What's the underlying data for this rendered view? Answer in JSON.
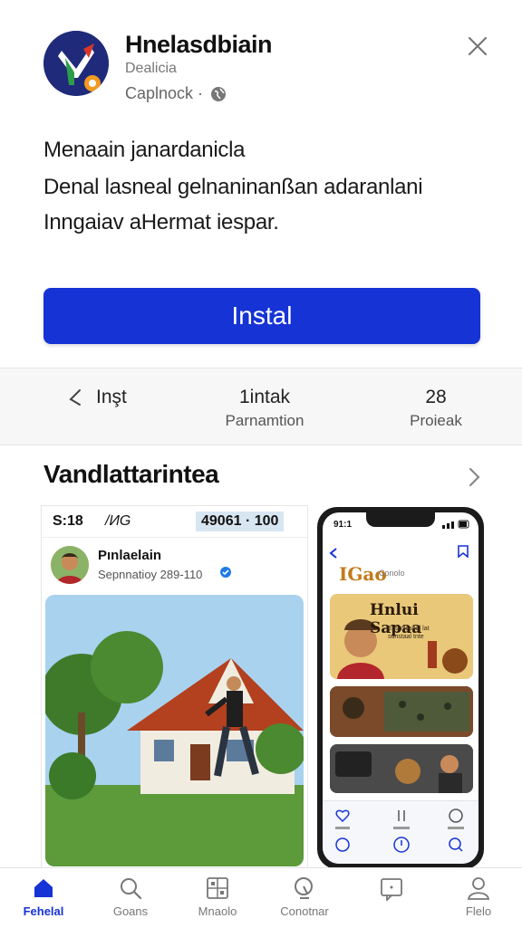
{
  "app": {
    "name": "Hnelasdbiain",
    "developer": "Dealicia",
    "category": "Caplnock ·"
  },
  "description": {
    "line1": "Menaain janardanicla",
    "line2": "Denal lasneal gelnaninanßan adaranlani",
    "line3": "Inngaiav aHermat iespar."
  },
  "install_label": "Instal",
  "stats": [
    {
      "value": "Inşt",
      "label": ""
    },
    {
      "value": "1intak",
      "label": "Parnamtion"
    },
    {
      "value": "28",
      "label": "Proieak"
    }
  ],
  "section_title": "Vandlattarintea",
  "screenshot1": {
    "status_time": "S:18",
    "status_mid": "/ИG",
    "status_right": "49061 · 100",
    "post_name": "Pınlaelain",
    "post_meta": "Sepnnatioy 289-110"
  },
  "screenshot2": {
    "status_time": "91:1",
    "logo_text": "IGao",
    "header_text": "Conolo",
    "card_title": "Hnlui Sapaa",
    "card_text": "Estanlaseal lat sunstaal tnte"
  },
  "tabs": [
    {
      "label": "Fehelal",
      "icon": "home-icon",
      "active": true
    },
    {
      "label": "Goans",
      "icon": "search-icon"
    },
    {
      "label": "Mnaolo",
      "icon": "grid-icon"
    },
    {
      "label": "Conotnar",
      "icon": "search-alt-icon"
    },
    {
      "label": "",
      "icon": "message-icon"
    },
    {
      "label": "Flelo",
      "icon": "profile-icon"
    }
  ],
  "colors": {
    "accent": "#1633d6",
    "icon_bg": "#1f2a7a"
  }
}
